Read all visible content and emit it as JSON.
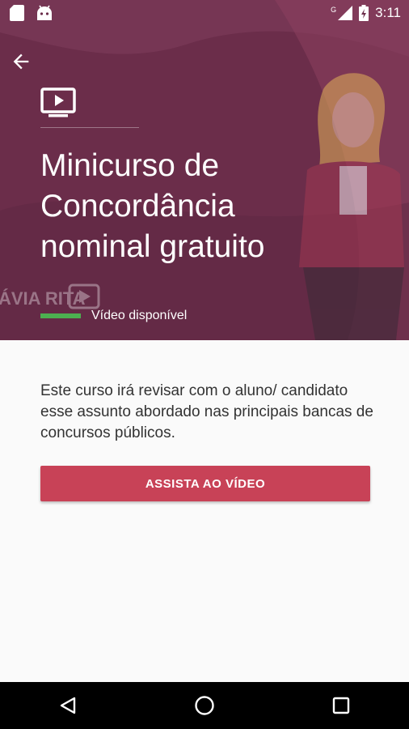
{
  "status_bar": {
    "time": "3:11",
    "network": "G"
  },
  "header": {
    "title": "Minicurso de Concordância nominal gratuito",
    "video_status": "Vídeo disponível",
    "video_progress": 1.0,
    "watermark_text": "ÁVIA RITA"
  },
  "content": {
    "description": "Este curso irá revisar com o aluno/ candidato esse assunto abordado nas principais bancas de concursos públicos.",
    "cta_label": "ASSISTA AO VÍDEO"
  },
  "colors": {
    "hero": "#6b2d4a",
    "accent": "#c84257",
    "progress": "#4caf50"
  },
  "icons": [
    "sd-card-icon",
    "android-icon",
    "signal-icon",
    "battery-icon",
    "back-arrow-icon",
    "tv-play-icon",
    "nav-back-icon",
    "nav-home-icon",
    "nav-recents-icon"
  ]
}
